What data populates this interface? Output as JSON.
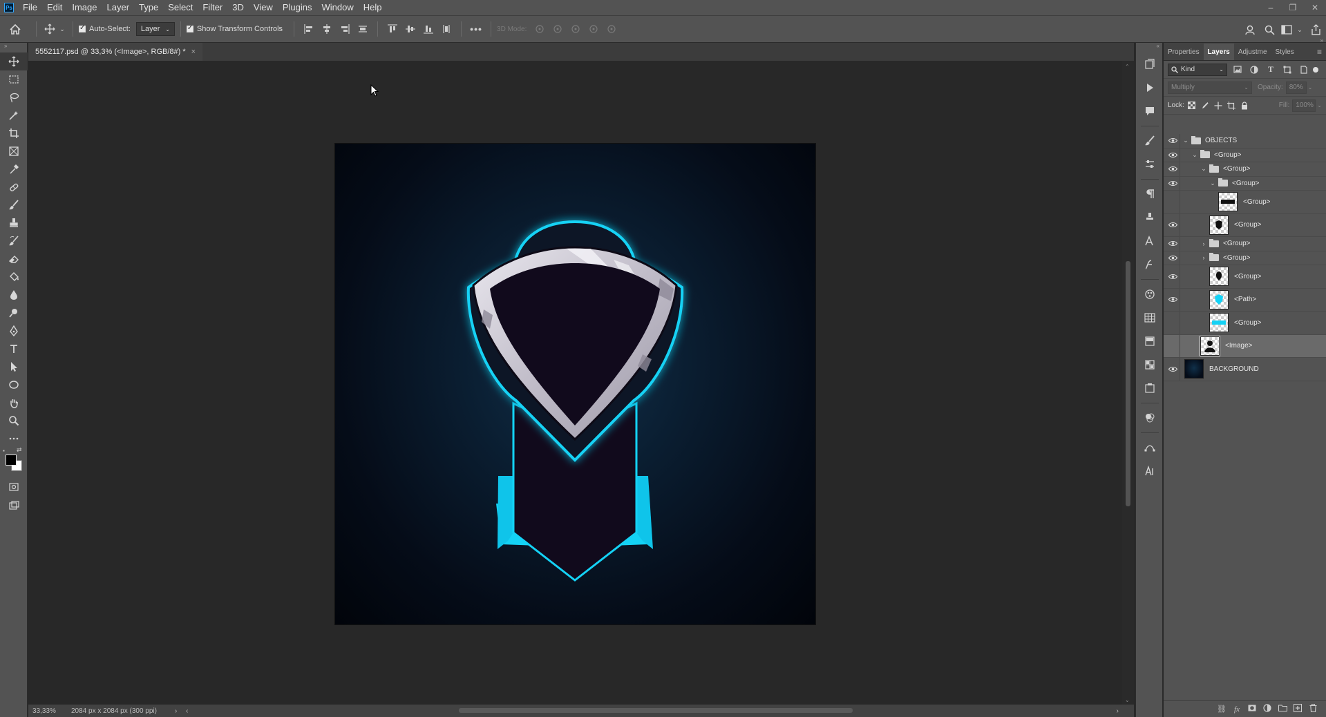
{
  "app": {
    "logo": "Ps"
  },
  "menu": [
    "File",
    "Edit",
    "Image",
    "Layer",
    "Type",
    "Select",
    "Filter",
    "3D",
    "View",
    "Plugins",
    "Window",
    "Help"
  ],
  "window_controls": {
    "minimize": "–",
    "restore": "❐",
    "close": "✕"
  },
  "options": {
    "auto_select_label": "Auto-Select:",
    "auto_select_value": "Layer",
    "show_transform_label": "Show Transform Controls",
    "more": "•••",
    "mode_3d_label": "3D Mode:"
  },
  "document": {
    "tab_title": "5552117.psd @ 33,3% (<Image>, RGB/8#) *",
    "close": "×",
    "zoom": "33,33%",
    "size_info": "2084 px x 2084 px (300 ppi)"
  },
  "panel": {
    "tabs": [
      "Properties",
      "Layers",
      "Adjustme",
      "Styles"
    ],
    "active_tab": "Layers",
    "kind_label": "Kind",
    "blend_mode": "Multiply",
    "opacity_label": "Opacity:",
    "opacity_value": "80%",
    "lock_label": "Lock:",
    "fill_label": "Fill:",
    "fill_value": "100%"
  },
  "layers": [
    {
      "name": "OBJECTS",
      "type": "folder",
      "depth": 0,
      "visible": true,
      "expanded": true
    },
    {
      "name": "<Group>",
      "type": "folder",
      "depth": 1,
      "visible": true,
      "expanded": true
    },
    {
      "name": "<Group>",
      "type": "folder",
      "depth": 2,
      "visible": true,
      "expanded": true
    },
    {
      "name": "<Group>",
      "type": "folder",
      "depth": 3,
      "visible": true,
      "expanded": true
    },
    {
      "name": "<Group>",
      "type": "layer",
      "depth": 3,
      "visible": false,
      "thumb": "text"
    },
    {
      "name": "<Group>",
      "type": "layer",
      "depth": 2,
      "visible": true,
      "thumb": "dark-shape"
    },
    {
      "name": "<Group>",
      "type": "folder",
      "depth": 2,
      "visible": true,
      "expanded": false
    },
    {
      "name": "<Group>",
      "type": "folder",
      "depth": 2,
      "visible": true,
      "expanded": false
    },
    {
      "name": "<Group>",
      "type": "layer",
      "depth": 2,
      "visible": true,
      "thumb": "dark-round"
    },
    {
      "name": "<Path>",
      "type": "layer",
      "depth": 2,
      "visible": true,
      "thumb": "cyan-shield"
    },
    {
      "name": "<Group>",
      "type": "layer",
      "depth": 2,
      "visible": false,
      "thumb": "cyan-bar"
    },
    {
      "name": "<Image>",
      "type": "layer",
      "depth": 1,
      "visible": false,
      "thumb": "silhouette",
      "selected": true
    },
    {
      "name": "BACKGROUND",
      "type": "layer",
      "depth": 0,
      "visible": true,
      "thumb": "navy"
    }
  ],
  "colors": {
    "accent_cyan": "#14d2f5",
    "shield_dark": "#110a1c",
    "shield_silver": "#cbc8cf",
    "panel_bg": "#535353"
  }
}
